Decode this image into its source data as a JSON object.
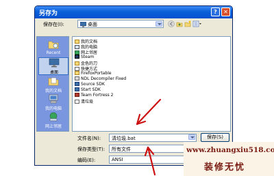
{
  "window": {
    "title": "另存为"
  },
  "titlebar": {
    "help_glyph": "?",
    "close_glyph": "✕"
  },
  "location": {
    "label": "保存在(I):",
    "value": "桌面"
  },
  "places": [
    {
      "label": "Recent",
      "icon": "recent-folder-icon",
      "selected": false
    },
    {
      "label": "桌面",
      "icon": "desktop-icon",
      "selected": true
    },
    {
      "label": "我的文档",
      "icon": "documents-icon",
      "selected": false
    },
    {
      "label": "我的电脑",
      "icon": "computer-icon",
      "selected": false
    },
    {
      "label": "网上邻居",
      "icon": "network-icon",
      "selected": false
    }
  ],
  "files": [
    {
      "name": "我的文档",
      "icon": "folder-icon"
    },
    {
      "name": "我的电脑",
      "icon": "computer-icon"
    },
    {
      "name": "网上邻居",
      "icon": "network-icon"
    },
    {
      "name": "Steam",
      "icon": "app-icon"
    },
    {
      "name": "金色的刀",
      "icon": "folder-icon"
    },
    {
      "name": "快捷方式",
      "icon": "shortcut-icon"
    },
    {
      "name": "FirefoxPortable",
      "icon": "folder-icon"
    },
    {
      "name": "NDL Decompiler Fixed",
      "icon": "app-icon"
    },
    {
      "name": "Source SDK",
      "icon": "app-icon"
    },
    {
      "name": "Start SDK",
      "icon": "app-icon"
    },
    {
      "name": "Team Fortress 2",
      "icon": "app-icon"
    },
    {
      "name": "清垃圾",
      "icon": "file-icon"
    }
  ],
  "filename": {
    "label": "文件名(N):",
    "value": "清垃圾.bat"
  },
  "filetype": {
    "label": "保存类型(T):",
    "value": "所有文件"
  },
  "encoding": {
    "label": "编码(E):",
    "value": "ANSI"
  },
  "buttons": {
    "save": "保存(S)",
    "cancel": "取消"
  },
  "watermark": {
    "url": "www.zhuangxiu518.com",
    "name": "装修无忧"
  },
  "colors": {
    "titlebar": "#0a5fd8",
    "arrow": "#cc1111",
    "places_bg": "#7a96df",
    "watermark_text": "#7a1c12"
  }
}
